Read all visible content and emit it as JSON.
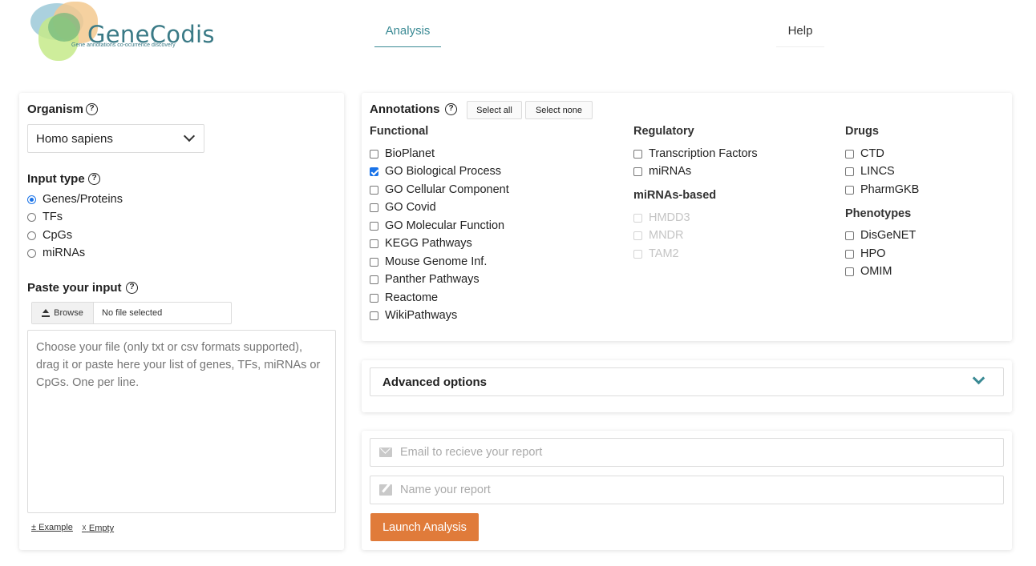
{
  "header": {
    "logo_title": "GeneCodis",
    "logo_tagline": "Gene annotations co-ocurrence discovery",
    "nav": {
      "analysis": "Analysis",
      "help": "Help"
    }
  },
  "organism": {
    "label": "Organism",
    "selected": "Homo sapiens"
  },
  "input_type": {
    "label": "Input type",
    "options": [
      "Genes/Proteins",
      "TFs",
      "CpGs",
      "miRNAs"
    ],
    "selected": "Genes/Proteins"
  },
  "paste": {
    "label": "Paste your input",
    "browse_label": "Browse",
    "file_status": "No file selected",
    "placeholder": "Choose your file (only txt or csv formats supported), drag it or paste here your list of genes, TFs, miRNAs or CpGs. One per line.",
    "example_link": "Example",
    "empty_link": "Empty",
    "example_prefix": "±",
    "empty_prefix": "☓"
  },
  "annotations": {
    "label": "Annotations",
    "select_all": "Select all",
    "select_none": "Select none",
    "functional": {
      "label": "Functional",
      "items": [
        "BioPlanet",
        "GO Biological Process",
        "GO Cellular Component",
        "GO Covid",
        "GO Molecular Function",
        "KEGG Pathways",
        "Mouse Genome Inf.",
        "Panther Pathways",
        "Reactome",
        "WikiPathways"
      ],
      "checked": [
        "GO Biological Process"
      ]
    },
    "regulatory": {
      "label": "Regulatory",
      "items": [
        "Transcription Factors",
        "miRNAs"
      ]
    },
    "mirnas_based": {
      "label": "miRNAs-based",
      "items": [
        "HMDD3",
        "MNDR",
        "TAM2"
      ],
      "disabled": true
    },
    "drugs": {
      "label": "Drugs",
      "items": [
        "CTD",
        "LINCS",
        "PharmGKB"
      ]
    },
    "phenotypes": {
      "label": "Phenotypes",
      "items": [
        "DisGeNET",
        "HPO",
        "OMIM"
      ]
    }
  },
  "advanced": {
    "label": "Advanced options"
  },
  "report": {
    "email_placeholder": "Email to recieve your report",
    "name_placeholder": "Name your report",
    "launch_label": "Launch Analysis"
  },
  "colors": {
    "accent": "#3a8a94",
    "launch": "#e07b3a",
    "checkbox": "#1a73e8"
  }
}
